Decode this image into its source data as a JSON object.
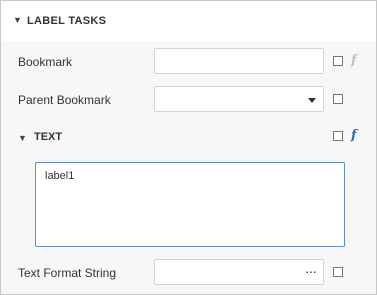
{
  "header": {
    "title": "LABEL TASKS"
  },
  "fields": {
    "bookmark": {
      "label": "Bookmark",
      "value": ""
    },
    "parent_bookmark": {
      "label": "Parent Bookmark",
      "value": ""
    },
    "text_format_string": {
      "label": "Text Format String",
      "value": ""
    }
  },
  "text_section": {
    "title": "TEXT",
    "value": "label1"
  },
  "glyphs": {
    "expand": "▼",
    "fx": "f",
    "ellipsis": "···"
  },
  "colors": {
    "fx_disabled": "#c0c0c0",
    "fx_active": "#2f6fb5",
    "focus_border": "#5b8fc9"
  }
}
